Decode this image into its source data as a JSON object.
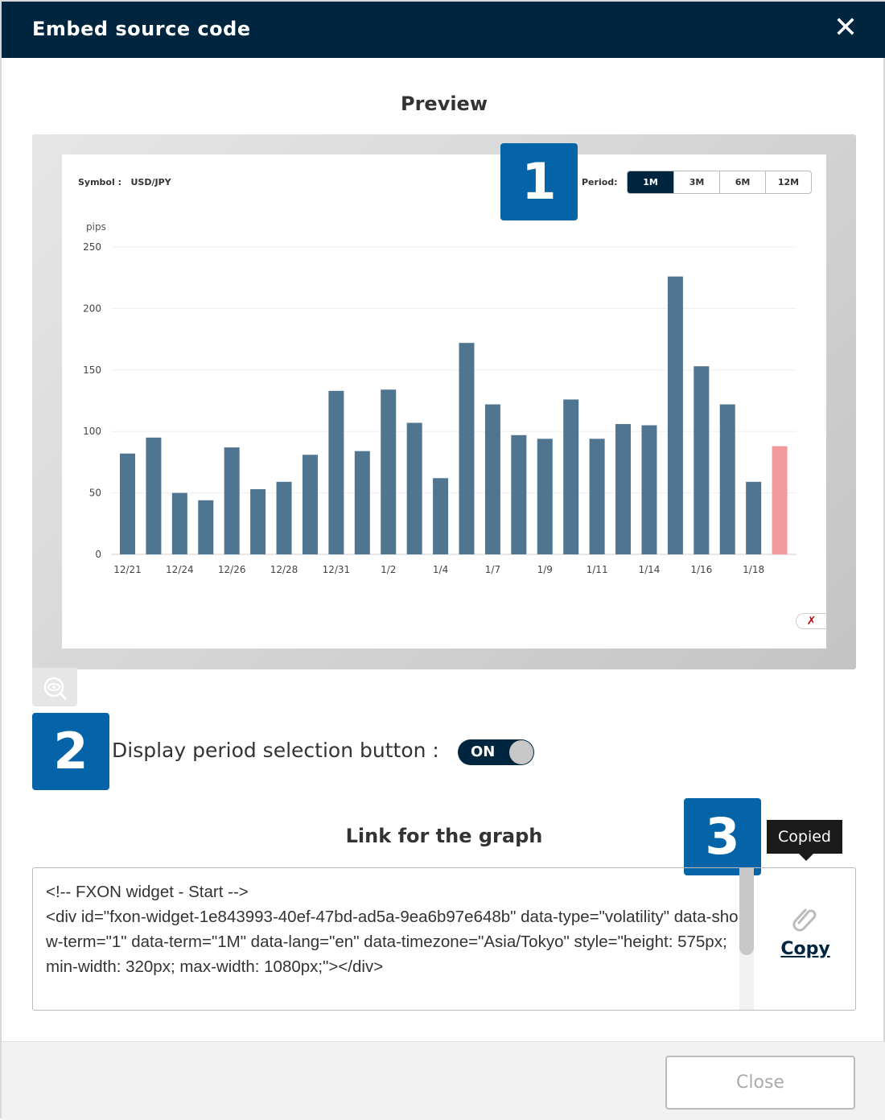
{
  "dialog": {
    "title": "Embed source code",
    "close_icon": "close-icon"
  },
  "preview": {
    "title": "Preview",
    "symbol_label": "Symbol :",
    "symbol_value": "USD/JPY",
    "period_label": "Period:",
    "periods": [
      "1M",
      "3M",
      "6M",
      "12M"
    ],
    "selected_period": "1M",
    "logo_text": "X"
  },
  "badges": [
    "1",
    "2",
    "3"
  ],
  "option": {
    "label": "Display period selection button :",
    "toggle": "ON"
  },
  "link": {
    "title": "Link for the graph",
    "code": "<!-- FXON widget - Start -->\n<div id=\"fxon-widget-1e843993-40ef-47bd-ad5a-9ea6b97e648b\" data-type=\"volatility\" data-show-term=\"1\" data-term=\"1M\" data-lang=\"en\" data-timezone=\"Asia/Tokyo\" style=\"height: 575px; min-width: 320px; max-width: 1080px;\"></div>",
    "copy_label": "Copy",
    "tooltip": "Copied"
  },
  "footer": {
    "close_label": "Close"
  },
  "colors": {
    "header": "#00263f",
    "badge": "#0563a8",
    "bar": "#4f7590",
    "bar_latest": "#f2999c"
  },
  "chart_data": {
    "type": "bar",
    "ylabel": "pips",
    "ylim": [
      0,
      250
    ],
    "yticks": [
      0,
      50,
      100,
      150,
      200,
      250
    ],
    "grid": true,
    "categories": [
      "12/21",
      "",
      "12/24",
      "",
      "12/26",
      "",
      "12/28",
      "",
      "12/31",
      "",
      "1/2",
      "",
      "1/4",
      "",
      "1/7",
      "",
      "1/9",
      "",
      "1/11",
      "",
      "1/14",
      "",
      "1/16",
      "",
      "1/18",
      ""
    ],
    "values": [
      82,
      95,
      50,
      44,
      87,
      53,
      59,
      81,
      133,
      84,
      134,
      107,
      62,
      172,
      122,
      97,
      94,
      126,
      94,
      106,
      105,
      226,
      153,
      122,
      59,
      88
    ]
  }
}
